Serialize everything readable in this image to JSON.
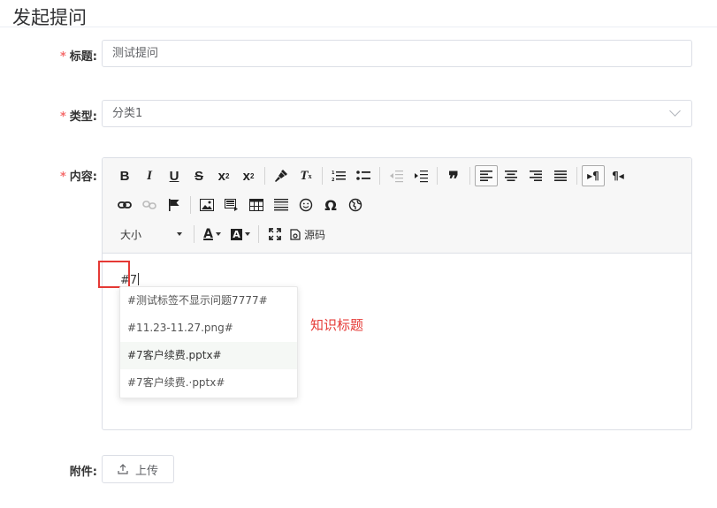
{
  "page": {
    "title": "发起提问"
  },
  "form": {
    "title_field": {
      "label": "标题:",
      "required_mark": "*",
      "value": "测试提问"
    },
    "type_field": {
      "label": "类型:",
      "required_mark": "*",
      "value": "分类1"
    },
    "content_field": {
      "label": "内容:",
      "required_mark": "*"
    },
    "attachment_field": {
      "label": "附件:",
      "upload_label": "上传"
    }
  },
  "editor": {
    "toolbar": {
      "font_size_label": "大小",
      "source_label": "源码",
      "icons": [
        "bold-icon",
        "italic-icon",
        "underline-icon",
        "strikethrough-icon",
        "subscript-icon",
        "superscript-icon",
        "format-painter-icon",
        "clear-format-icon",
        "ordered-list-icon",
        "unordered-list-icon",
        "outdent-icon",
        "indent-icon",
        "blockquote-icon",
        "align-left-icon",
        "align-center-icon",
        "align-right-icon",
        "align-justify-icon",
        "ltr-icon",
        "rtl-icon",
        "link-icon",
        "unlink-icon",
        "anchor-icon",
        "image-icon",
        "multi-image-icon",
        "table-icon",
        "page-break-icon",
        "emoji-icon",
        "special-char-icon",
        "map-icon",
        "font-color-icon",
        "background-color-icon",
        "fullscreen-icon",
        "source-icon"
      ]
    },
    "content_text": "#7",
    "suggestions": [
      "#测试标签不显示问题7777#",
      "#11.23-11.27.png#",
      "#7客户续费.pptx#",
      "#7客户续费.·pptx#"
    ],
    "active_suggestion_index": 2
  },
  "annotation": {
    "text": "知识标题"
  },
  "colors": {
    "required": "#f56c6c",
    "annotation": "#e53935",
    "border": "#dcdfe6"
  }
}
